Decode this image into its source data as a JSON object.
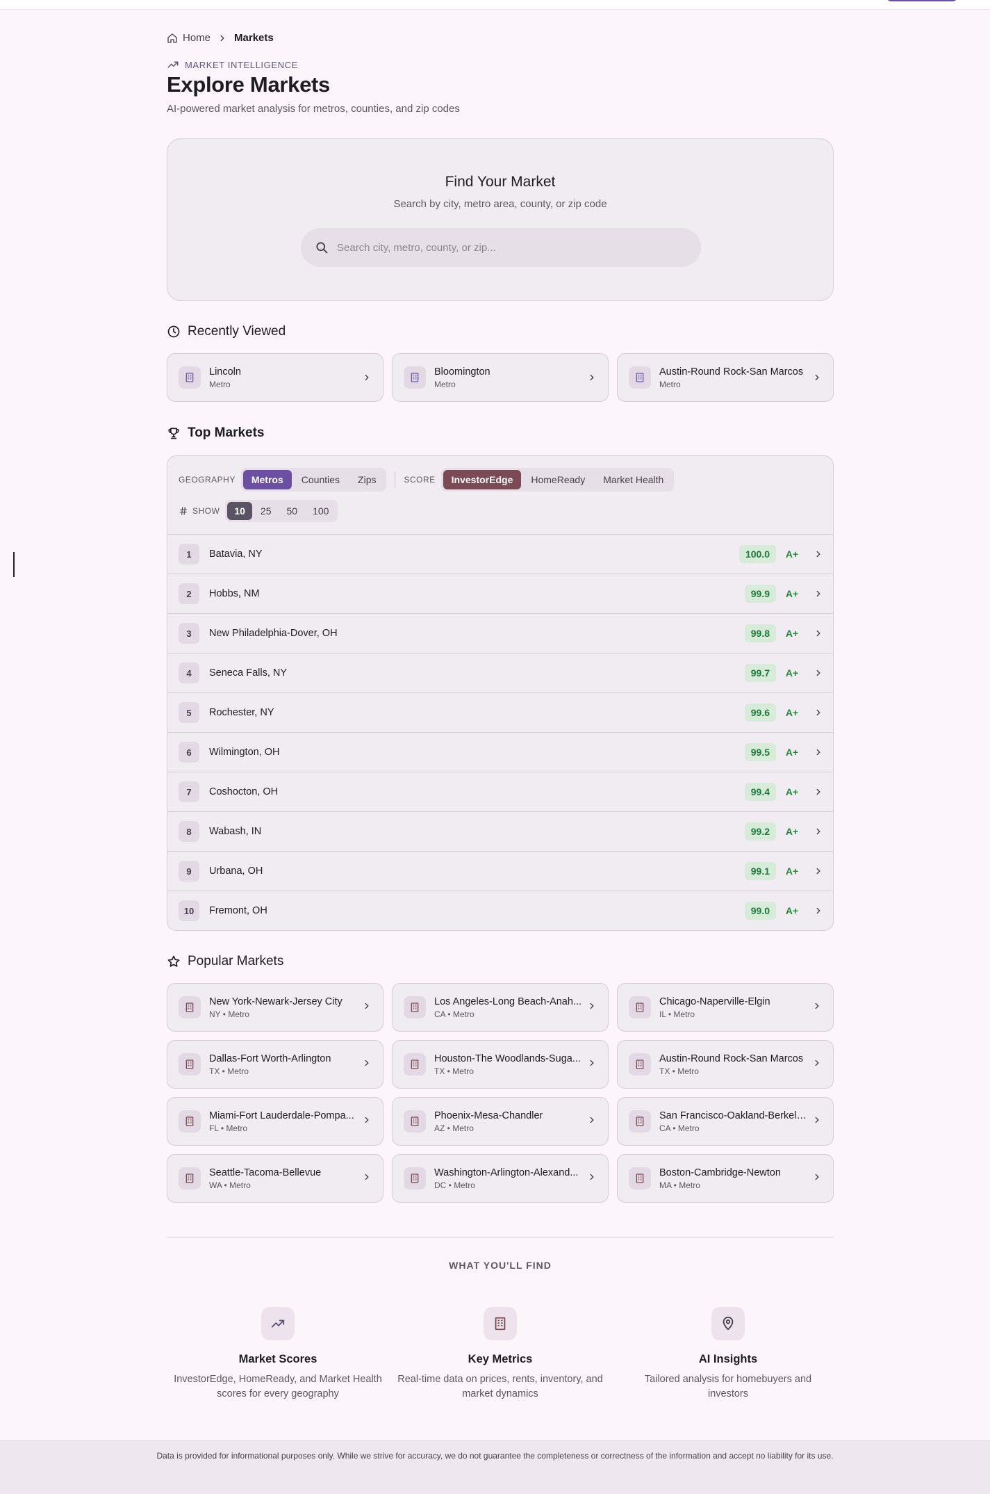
{
  "breadcrumb": {
    "home": "Home",
    "current": "Markets"
  },
  "header": {
    "eyebrow": "MARKET INTELLIGENCE",
    "title": "Explore Markets",
    "subtitle": "AI-powered market analysis for metros, counties, and zip codes"
  },
  "search": {
    "title": "Find Your Market",
    "subtitle": "Search by city, metro area, county, or zip code",
    "placeholder": "Search city, metro, county, or zip..."
  },
  "recent": {
    "title": "Recently Viewed",
    "items": [
      {
        "name": "Lincoln",
        "sub": "Metro"
      },
      {
        "name": "Bloomington",
        "sub": "Metro"
      },
      {
        "name": "Austin-Round Rock-San Marcos",
        "sub": "Metro"
      }
    ]
  },
  "top": {
    "title": "Top Markets",
    "geography_label": "GEOGRAPHY",
    "geography_options": [
      "Metros",
      "Counties",
      "Zips"
    ],
    "geography_selected": "Metros",
    "score_label": "SCORE",
    "score_options": [
      "InvestorEdge",
      "HomeReady",
      "Market Health"
    ],
    "score_selected": "InvestorEdge",
    "show_label": "SHOW",
    "show_options": [
      "10",
      "25",
      "50",
      "100"
    ],
    "show_selected": "10",
    "rows": [
      {
        "rank": "1",
        "name": "Batavia, NY",
        "score": "100.0",
        "grade": "A+"
      },
      {
        "rank": "2",
        "name": "Hobbs, NM",
        "score": "99.9",
        "grade": "A+"
      },
      {
        "rank": "3",
        "name": "New Philadelphia-Dover, OH",
        "score": "99.8",
        "grade": "A+"
      },
      {
        "rank": "4",
        "name": "Seneca Falls, NY",
        "score": "99.7",
        "grade": "A+"
      },
      {
        "rank": "5",
        "name": "Rochester, NY",
        "score": "99.6",
        "grade": "A+"
      },
      {
        "rank": "6",
        "name": "Wilmington, OH",
        "score": "99.5",
        "grade": "A+"
      },
      {
        "rank": "7",
        "name": "Coshocton, OH",
        "score": "99.4",
        "grade": "A+"
      },
      {
        "rank": "8",
        "name": "Wabash, IN",
        "score": "99.2",
        "grade": "A+"
      },
      {
        "rank": "9",
        "name": "Urbana, OH",
        "score": "99.1",
        "grade": "A+"
      },
      {
        "rank": "10",
        "name": "Fremont, OH",
        "score": "99.0",
        "grade": "A+"
      }
    ]
  },
  "popular": {
    "title": "Popular Markets",
    "items": [
      {
        "name": "New York-Newark-Jersey City",
        "sub": "NY • Metro"
      },
      {
        "name": "Los Angeles-Long Beach-Anah...",
        "sub": "CA • Metro"
      },
      {
        "name": "Chicago-Naperville-Elgin",
        "sub": "IL • Metro"
      },
      {
        "name": "Dallas-Fort Worth-Arlington",
        "sub": "TX • Metro"
      },
      {
        "name": "Houston-The Woodlands-Suga...",
        "sub": "TX • Metro"
      },
      {
        "name": "Austin-Round Rock-San Marcos",
        "sub": "TX • Metro"
      },
      {
        "name": "Miami-Fort Lauderdale-Pompa...",
        "sub": "FL • Metro"
      },
      {
        "name": "Phoenix-Mesa-Chandler",
        "sub": "AZ • Metro"
      },
      {
        "name": "San Francisco-Oakland-Berkeley",
        "sub": "CA • Metro"
      },
      {
        "name": "Seattle-Tacoma-Bellevue",
        "sub": "WA • Metro"
      },
      {
        "name": "Washington-Arlington-Alexand...",
        "sub": "DC • Metro"
      },
      {
        "name": "Boston-Cambridge-Newton",
        "sub": "MA • Metro"
      }
    ]
  },
  "features": {
    "heading": "WHAT YOU'LL FIND",
    "items": [
      {
        "icon": "trending-up-icon",
        "title": "Market Scores",
        "desc": "InvestorEdge, HomeReady, and Market Health scores for every geography"
      },
      {
        "icon": "building-icon",
        "title": "Key Metrics",
        "desc": "Real-time data on prices, rents, inventory, and market dynamics"
      },
      {
        "icon": "map-pin-icon",
        "title": "AI Insights",
        "desc": "Tailored analysis for homebuyers and investors"
      }
    ]
  },
  "footer": {
    "disclaimer": "Data is provided for informational purposes only. While we strive for accuracy, we do not guarantee the completeness or correctness of the information and accept no liability for its use."
  },
  "colors": {
    "accent_purple": "#6a4fa3",
    "accent_wine": "#7a4a55",
    "score_green": "#1e7a3c",
    "background": "#fcf5fb"
  }
}
